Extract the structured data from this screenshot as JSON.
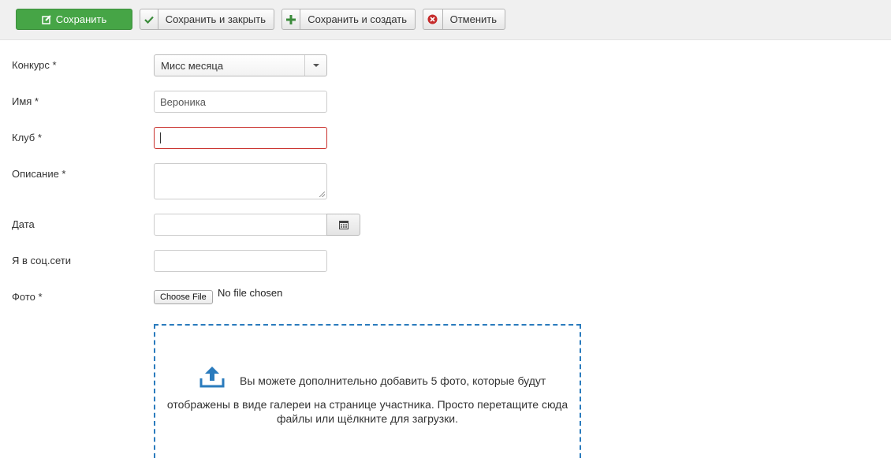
{
  "toolbar": {
    "save_label": "Сохранить",
    "save_close_label": "Сохранить и закрыть",
    "save_new_label": "Сохранить и создать",
    "cancel_label": "Отменить"
  },
  "form": {
    "contest_label": "Конкурс *",
    "contest_value": "Мисс месяца",
    "name_label": "Имя *",
    "name_value": "Вероника",
    "club_label": "Клуб *",
    "club_value": "",
    "description_label": "Описание *",
    "date_label": "Дата",
    "social_label": "Я в соц.сети",
    "photo_label": "Фото *",
    "choose_file_label": "Choose File",
    "no_file_text": "No file chosen"
  },
  "dropzone": {
    "line1": "Вы можете дополнительно добавить 5 фото, которые будут",
    "line2": "отображены в виде галереи на странице участника. Просто перетащите сюда файлы или щёлкните для загрузки."
  },
  "colors": {
    "save_button": "#46a546",
    "error_border": "#c9302c",
    "dropzone_border": "#2a7bbd",
    "cancel_icon": "#c52a2a",
    "check_icon": "#3b8b3b"
  },
  "icons": {
    "save": "edit-icon",
    "save_close": "check-icon",
    "save_new": "plus-icon",
    "cancel": "cancel-circle-icon",
    "date": "calendar-icon",
    "upload": "upload-icon"
  }
}
